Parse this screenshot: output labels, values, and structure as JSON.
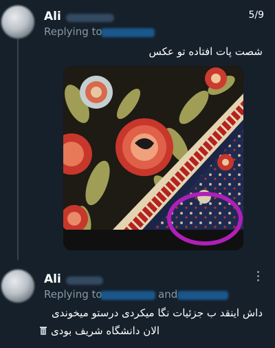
{
  "tweet1": {
    "name": "Ali",
    "counter": "5/9",
    "replying_label": "Replying to",
    "text": "شصت پات افتاده تو عکس"
  },
  "tweet2": {
    "name": "Ali",
    "replying_label": "Replying to",
    "and_label": "and",
    "line1": "داش اینقد ب جزئیات نگا میکردی درستو میخوندی",
    "line2": "الان دانشگاه شریف بودی",
    "emoji_icon": "trash-can-emoji-icon"
  },
  "colors": {
    "background": "#15202b",
    "secondary_text": "#8899a6",
    "mention_blue": "#1d9bf0",
    "highlight_circle": "#b01fb8"
  },
  "icons": [
    "more-options-icon"
  ]
}
